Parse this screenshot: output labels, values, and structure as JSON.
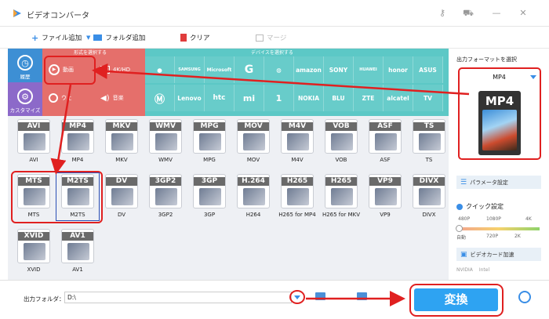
{
  "window": {
    "title": "ビデオコンバータ",
    "logo_icon": "app-logo-icon"
  },
  "toolbar": {
    "add_file": "ファイル追加",
    "add_folder": "フォルダ追加",
    "clear": "クリア",
    "merge": "マージ"
  },
  "sidebar": {
    "history": "履歴",
    "customize": "カスタマイズ"
  },
  "category": {
    "format_header": "形式を選択する",
    "device_header": "デバイスを選択する",
    "video": "動画",
    "fourk": "4K/HD",
    "web": "ウェ",
    "music": "音楽"
  },
  "brands_row1": [
    "",
    "SAMSUNG",
    "Microsoft",
    "G",
    "",
    "amazon",
    "SONY",
    "HUAWEI",
    "honor",
    "ASUS"
  ],
  "brands_row2": [
    "",
    "Lenovo",
    "htc",
    "mi",
    "1",
    "NOKIA",
    "BLU",
    "ZTE",
    "alcatel",
    "TV"
  ],
  "formats_row1": [
    {
      "badge": "AVI",
      "name": "AVI"
    },
    {
      "badge": "MP4",
      "name": "MP4"
    },
    {
      "badge": "MKV",
      "name": "MKV"
    },
    {
      "badge": "WMV",
      "name": "WMV"
    },
    {
      "badge": "MPG",
      "name": "MPG"
    },
    {
      "badge": "MOV",
      "name": "MOV"
    },
    {
      "badge": "M4V",
      "name": "M4V"
    },
    {
      "badge": "VOB",
      "name": "VOB"
    },
    {
      "badge": "ASF",
      "name": "ASF"
    },
    {
      "badge": "TS",
      "name": "TS"
    }
  ],
  "formats_row2": [
    {
      "badge": "MTS",
      "name": "MTS"
    },
    {
      "badge": "M2TS",
      "name": "M2TS"
    },
    {
      "badge": "DV",
      "name": "DV"
    },
    {
      "badge": "3GP2",
      "name": "3GP2"
    },
    {
      "badge": "3GP",
      "name": "3GP"
    },
    {
      "badge": "H.264",
      "name": "H264"
    },
    {
      "badge": "H265",
      "name": "H265 for MP4"
    },
    {
      "badge": "H265",
      "name": "H265 for MKV"
    },
    {
      "badge": "VP9",
      "name": "VP9"
    },
    {
      "badge": "DIVX",
      "name": "DIVX"
    }
  ],
  "formats_row3": [
    {
      "badge": "XVID",
      "name": "XVID"
    },
    {
      "badge": "AV1",
      "name": "AV1"
    }
  ],
  "right_panel": {
    "header": "出力フォーマットを選択",
    "selected": "MP4",
    "icon_label": "MP4",
    "params": "パラメータ設定",
    "quick": "クイック設定",
    "ticks_top": [
      "480P",
      "1080P",
      "4K"
    ],
    "ticks_bottom": [
      "自動",
      "720P",
      "2K"
    ],
    "gpu_header": "ビデオカード加速",
    "gpu_opts": [
      "NVIDIA",
      "Intel"
    ]
  },
  "bottom": {
    "output_label": "出力フォルダ：",
    "path": "D:\\",
    "convert": "変換"
  },
  "colors": {
    "red_section": "#e56f6b",
    "teal_section": "#5cc8c6",
    "accent": "#2ea3f2",
    "highlight": "#e02020"
  }
}
